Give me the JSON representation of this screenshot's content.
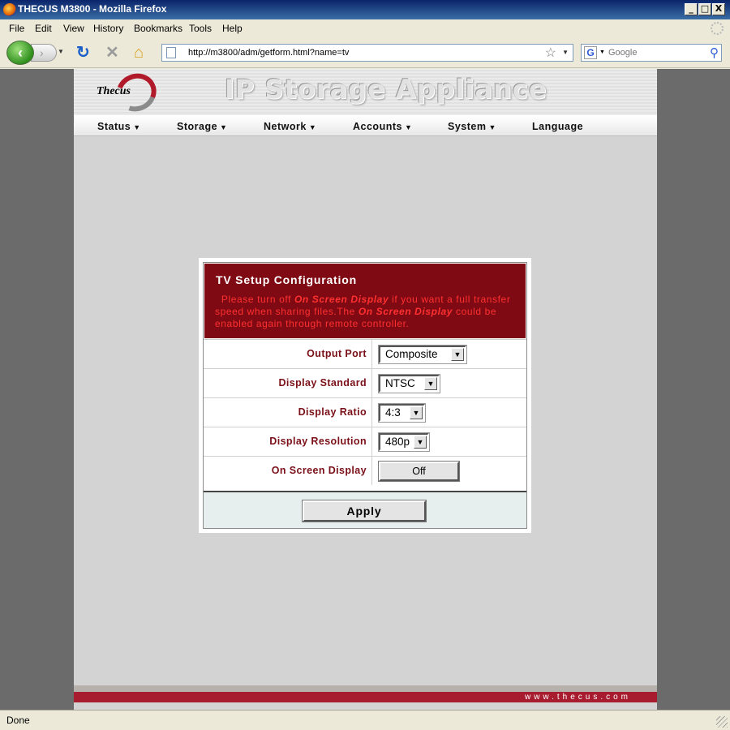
{
  "window": {
    "title": "THECUS M3800 - Mozilla Firefox",
    "controls": [
      "_",
      "□",
      "X"
    ]
  },
  "menu": [
    "File",
    "Edit",
    "View",
    "History",
    "Bookmarks",
    "Tools",
    "Help"
  ],
  "toolbar": {
    "url": "http://m3800/adm/getform.html?name=tv",
    "search_placeholder": "Google",
    "icons": [
      "back-icon",
      "forward-icon",
      "reload-icon",
      "stop-icon",
      "home-icon",
      "bookmark-star-icon",
      "search-icon"
    ]
  },
  "site": {
    "logo_text": "Thecus",
    "banner_title": "IP Storage Appliance",
    "nav": [
      {
        "label": "Status",
        "has_menu": true
      },
      {
        "label": "Storage",
        "has_menu": true
      },
      {
        "label": "Network",
        "has_menu": true
      },
      {
        "label": "Accounts",
        "has_menu": true
      },
      {
        "label": "System",
        "has_menu": true
      },
      {
        "label": "Language",
        "has_menu": false
      }
    ],
    "footer_url": "www.thecus.com"
  },
  "dialog": {
    "title": "TV Setup Configuration",
    "note_parts": [
      "Please turn off ",
      "On Screen Display",
      " if you want a full transfer speed when sharing files.The ",
      "On Screen Display",
      " could be enabled again through remote controller."
    ],
    "fields": [
      {
        "label": "Output Port",
        "value": "Composite",
        "type": "select"
      },
      {
        "label": "Display Standard",
        "value": "NTSC",
        "type": "select"
      },
      {
        "label": "Display Ratio",
        "value": "4:3",
        "type": "select"
      },
      {
        "label": "Display Resolution",
        "value": "480p",
        "type": "select"
      },
      {
        "label": "On Screen Display",
        "value": "Off",
        "type": "button"
      }
    ],
    "apply_label": "Apply"
  },
  "status": {
    "text": "Done"
  },
  "colors": {
    "accent": "#800a13",
    "label": "#7a1018",
    "footer": "#a81c30"
  }
}
